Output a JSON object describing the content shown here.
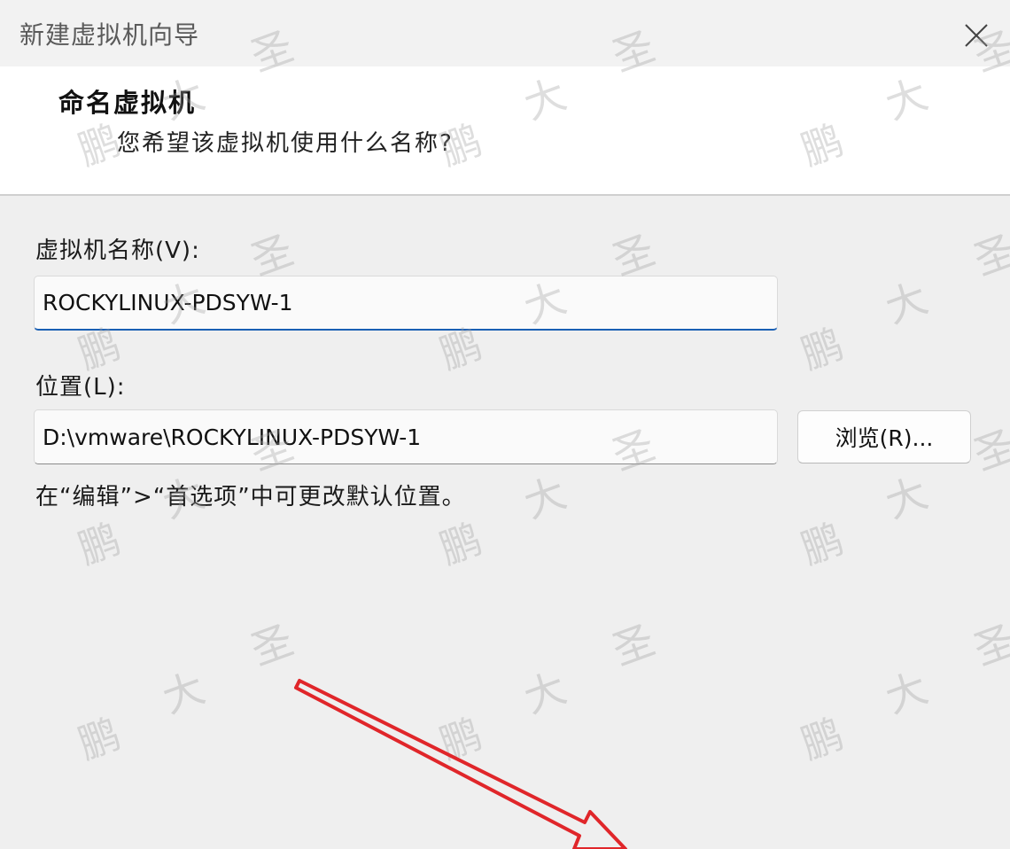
{
  "window": {
    "title": "新建虚拟机向导",
    "close_icon": "close-icon"
  },
  "header": {
    "title": "命名虚拟机",
    "subtitle": "您希望该虚拟机使用什么名称?"
  },
  "form": {
    "name_label": "虚拟机名称(V):",
    "name_value": "ROCKYLINUX-PDSYW-1",
    "location_label": "位置(L):",
    "location_value": "D:\\vmware\\ROCKYLINUX-PDSYW-1",
    "browse_label": "浏览(R)...",
    "hint": "在“编辑”>“首选项”中可更改默认位置。"
  },
  "watermark": {
    "chars": [
      "鹏",
      "大",
      "圣"
    ]
  },
  "annotation": {
    "arrow_color": "#e0262a"
  },
  "colors": {
    "focus_underline": "#1a5fb4",
    "background": "#efefef",
    "header_background": "#ffffff"
  }
}
